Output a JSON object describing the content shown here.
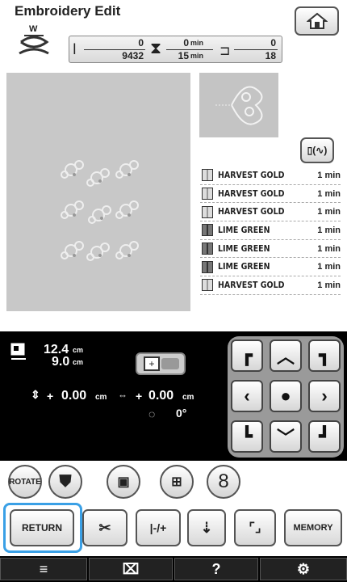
{
  "header": {
    "title": "Embroidery Edit",
    "home_icon": "home-icon"
  },
  "status": {
    "stitch_current": "0",
    "stitch_total": "9432",
    "time_current": "0",
    "time_current_unit": "min",
    "time_total": "15",
    "time_total_unit": "min",
    "color_current": "0",
    "color_total": "18",
    "thread_icon_label": "W"
  },
  "threads": [
    {
      "name": "HARVEST GOLD",
      "time": "1 min",
      "color": "gold"
    },
    {
      "name": "HARVEST GOLD",
      "time": "1 min",
      "color": "gold"
    },
    {
      "name": "HARVEST GOLD",
      "time": "1 min",
      "color": "gold"
    },
    {
      "name": "LIME GREEN",
      "time": "1 min",
      "color": "green"
    },
    {
      "name": "LIME GREEN",
      "time": "1 min",
      "color": "green"
    },
    {
      "name": "LIME GREEN",
      "time": "1 min",
      "color": "green"
    },
    {
      "name": "HARVEST GOLD",
      "time": "1 min",
      "color": "gold"
    }
  ],
  "size": {
    "height": "12.4",
    "width": "9.0",
    "unit": "cm"
  },
  "offset": {
    "vertical_sign": "+",
    "vertical": "0.00",
    "horizontal_sign": "+",
    "horizontal": "0.00",
    "unit": "cm",
    "angle": "0°"
  },
  "round_buttons": {
    "rotate_label": "ROTATE",
    "number_label": "8"
  },
  "bottom_row": {
    "return_label": "RETURN",
    "memory_label": "MEMORY"
  },
  "nav": {
    "help_label": "?"
  },
  "colors": {
    "highlight": "#3aa0e6",
    "panel_bg": "#000000",
    "work_area": "#c8c8c8"
  }
}
